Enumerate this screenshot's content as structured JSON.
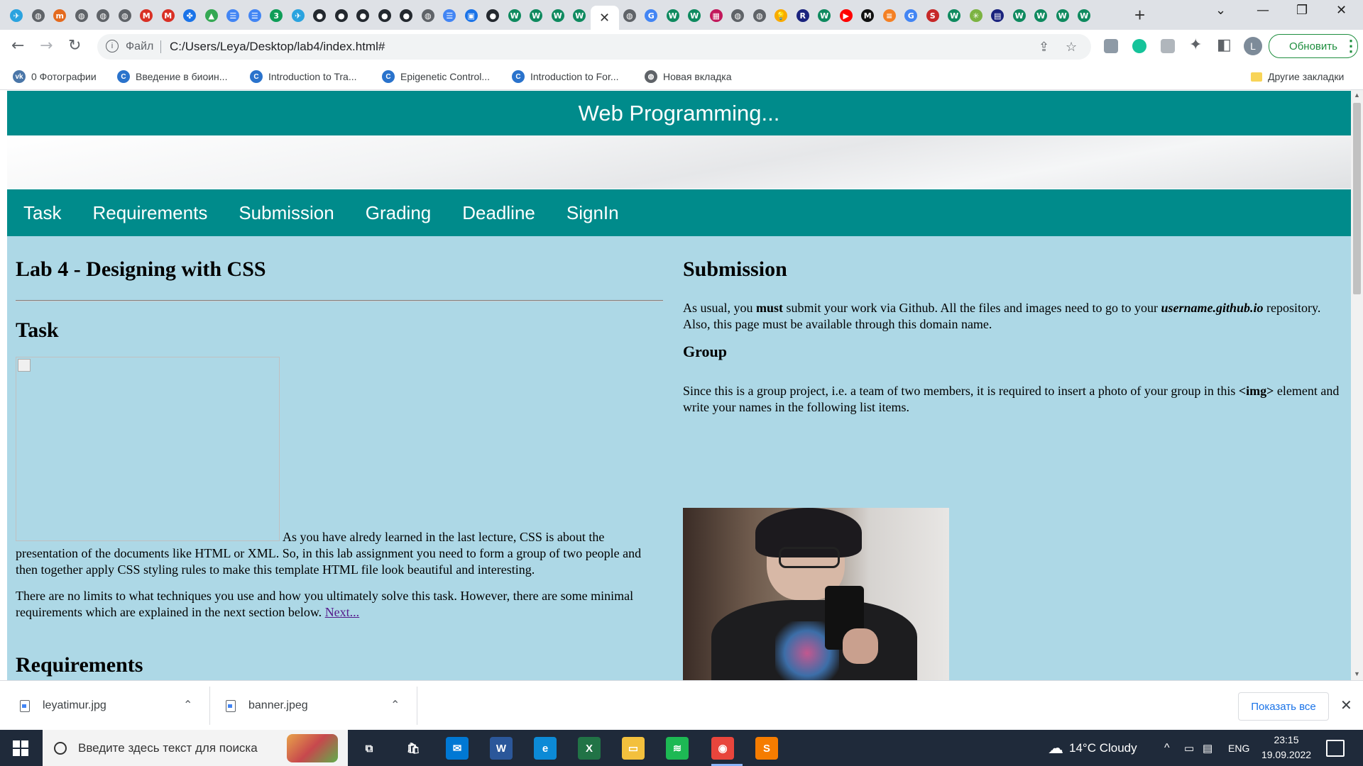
{
  "browser": {
    "tabs": [
      {
        "icon": "telegram-icon",
        "glyph": "✈",
        "color": "#2aa3df"
      },
      {
        "icon": "globe-icon",
        "glyph": "◍",
        "color": "#5f6368"
      },
      {
        "icon": "site-icon",
        "glyph": "m",
        "color": "#e46a1e"
      },
      {
        "icon": "globe-icon",
        "glyph": "◍",
        "color": "#5f6368"
      },
      {
        "icon": "globe-icon",
        "glyph": "◍",
        "color": "#5f6368"
      },
      {
        "icon": "globe-icon",
        "glyph": "◍",
        "color": "#5f6368"
      },
      {
        "icon": "gmail-icon",
        "glyph": "M",
        "color": "#d93025"
      },
      {
        "icon": "gmail-icon",
        "glyph": "M",
        "color": "#d93025"
      },
      {
        "icon": "apps-icon",
        "glyph": "✤",
        "color": "#1a73e8"
      },
      {
        "icon": "drive-icon",
        "glyph": "▲",
        "color": "#34a853"
      },
      {
        "icon": "docs-icon",
        "glyph": "☰",
        "color": "#4285f4"
      },
      {
        "icon": "docs-icon",
        "glyph": "☰",
        "color": "#4285f4"
      },
      {
        "icon": "counter-icon",
        "glyph": "3",
        "color": "#0f9d58"
      },
      {
        "icon": "telegram-icon",
        "glyph": "✈",
        "color": "#2aa3df"
      },
      {
        "icon": "github-icon",
        "glyph": "●",
        "color": "#24292f"
      },
      {
        "icon": "github-icon",
        "glyph": "●",
        "color": "#24292f"
      },
      {
        "icon": "github-icon",
        "glyph": "●",
        "color": "#24292f"
      },
      {
        "icon": "github-icon",
        "glyph": "●",
        "color": "#24292f"
      },
      {
        "icon": "github-icon",
        "glyph": "●",
        "color": "#24292f"
      },
      {
        "icon": "globe-icon",
        "glyph": "◍",
        "color": "#5f6368"
      },
      {
        "icon": "docs-icon",
        "glyph": "☰",
        "color": "#4285f4"
      },
      {
        "icon": "chat-icon",
        "glyph": "▣",
        "color": "#1a73e8"
      },
      {
        "icon": "github-icon",
        "glyph": "●",
        "color": "#24292f"
      },
      {
        "icon": "w-icon",
        "glyph": "W",
        "color": "#0f8a5f"
      },
      {
        "icon": "w-icon",
        "glyph": "W",
        "color": "#0f8a5f"
      },
      {
        "icon": "w-icon",
        "glyph": "W",
        "color": "#0f8a5f"
      },
      {
        "icon": "w-icon",
        "glyph": "W",
        "color": "#0f8a5f"
      },
      {
        "icon": "active-tab",
        "glyph": "✕",
        "color": "#333333",
        "active": true
      },
      {
        "icon": "globe-icon",
        "glyph": "◍",
        "color": "#5f6368"
      },
      {
        "icon": "google-icon",
        "glyph": "G",
        "color": "#4285f4"
      },
      {
        "icon": "w-icon",
        "glyph": "W",
        "color": "#0f8a5f"
      },
      {
        "icon": "w-icon",
        "glyph": "W",
        "color": "#0f8a5f"
      },
      {
        "icon": "grid-icon",
        "glyph": "▦",
        "color": "#c2185b"
      },
      {
        "icon": "globe-icon",
        "glyph": "◍",
        "color": "#5f6368"
      },
      {
        "icon": "globe-icon",
        "glyph": "◍",
        "color": "#5f6368"
      },
      {
        "icon": "bulb-icon",
        "glyph": "💡",
        "color": "#f9ab00"
      },
      {
        "icon": "r-icon",
        "glyph": "R",
        "color": "#1a237e"
      },
      {
        "icon": "w-icon",
        "glyph": "W",
        "color": "#0f8a5f"
      },
      {
        "icon": "youtube-icon",
        "glyph": "▶",
        "color": "#ff0000"
      },
      {
        "icon": "m-icon",
        "glyph": "M",
        "color": "#111111"
      },
      {
        "icon": "stack-icon",
        "glyph": "≡",
        "color": "#f48024"
      },
      {
        "icon": "google-icon",
        "glyph": "G",
        "color": "#4285f4"
      },
      {
        "icon": "sfu-icon",
        "glyph": "S",
        "color": "#c62828"
      },
      {
        "icon": "w-icon",
        "glyph": "W",
        "color": "#0f8a5f"
      },
      {
        "icon": "star-icon",
        "glyph": "✳",
        "color": "#7cb342"
      },
      {
        "icon": "book-icon",
        "glyph": "▤",
        "color": "#1a237e"
      },
      {
        "icon": "w-icon",
        "glyph": "W",
        "color": "#0f8a5f"
      },
      {
        "icon": "w-icon",
        "glyph": "W",
        "color": "#0f8a5f"
      },
      {
        "icon": "w-icon",
        "glyph": "W",
        "color": "#0f8a5f"
      },
      {
        "icon": "w-icon",
        "glyph": "W",
        "color": "#0f8a5f"
      }
    ],
    "address": {
      "scheme_label": "Файл",
      "url": "C:/Users/Leya/Desktop/lab4/index.html#"
    },
    "profile_initial": "L",
    "update_label": "Обновить",
    "bookmarks": [
      {
        "label": "0 Фотографии",
        "icon": "vk-icon",
        "glyph": "vk",
        "color": "#4a76a8"
      },
      {
        "label": "Введение в биоин...",
        "icon": "coursera-icon",
        "glyph": "C",
        "color": "#2a73cc"
      },
      {
        "label": "Introduction to Tra...",
        "icon": "coursera-icon",
        "glyph": "C",
        "color": "#2a73cc"
      },
      {
        "label": "Epigenetic Control...",
        "icon": "coursera-icon",
        "glyph": "C",
        "color": "#2a73cc"
      },
      {
        "label": "Introduction to For...",
        "icon": "coursera-icon",
        "glyph": "C",
        "color": "#2a73cc"
      },
      {
        "label": "Новая вкладка",
        "icon": "globe-icon",
        "glyph": "◍",
        "color": "#5f6368"
      }
    ],
    "other_bookmarks": "Другие закладки"
  },
  "page": {
    "site_title": "Web Programming...",
    "nav": [
      "Task",
      "Requirements",
      "Submission",
      "Grading",
      "Deadline",
      "SignIn"
    ],
    "left": {
      "lab_title": "Lab 4 - Designing with CSS",
      "task_heading": "Task",
      "task_p1": "As you have alredy learned in the last lecture, CSS is about the presentation of the documents like HTML or XML. So, in this lab assignment you need to form a group of two people and then together apply CSS styling rules to make this template HTML file look beautiful and interesting.",
      "task_p2_text": "There are no limits to what techniques you use and how you ultimately solve this task. However, there are some minimal requirements which are explained in the next section below. ",
      "task_p2_link": "Next...",
      "req_heading": "Requirements"
    },
    "right": {
      "sub_heading": "Submission",
      "sub_p_1": "As usual, you ",
      "sub_p_strong": "must",
      "sub_p_2": " submit your work via Github. All the files and images need to go to your ",
      "sub_p_em": "username.github.io",
      "sub_p_3": " repository. Also, this page must be available through this domain name.",
      "group_heading": "Group",
      "group_p_1": "Since this is a group project, i.e. a team of two members, it is required to insert a photo of your group in this ",
      "group_p_code": "<img>",
      "group_p_2": " element and write your names in the following list items."
    }
  },
  "downloads": {
    "items": [
      "leyatimur.jpg",
      "banner.jpeg"
    ],
    "show_all": "Показать все"
  },
  "taskbar": {
    "search_placeholder": "Введите здесь текст для поиска",
    "weather": "14°C  Cloudy",
    "lang": "ENG",
    "time": "23:15",
    "date": "19.09.2022",
    "apps": [
      {
        "name": "task-view-icon",
        "glyph": "⧉",
        "color": "transparent"
      },
      {
        "name": "store-icon",
        "glyph": "🛍",
        "color": "transparent"
      },
      {
        "name": "mail-icon",
        "glyph": "✉",
        "color": "#0078d4"
      },
      {
        "name": "word-icon",
        "glyph": "W",
        "color": "#2b579a"
      },
      {
        "name": "edge-icon",
        "glyph": "e",
        "color": "#0c8ad6"
      },
      {
        "name": "excel-icon",
        "glyph": "X",
        "color": "#217346"
      },
      {
        "name": "explorer-icon",
        "glyph": "▭",
        "color": "#f3c03d"
      },
      {
        "name": "spotify-icon",
        "glyph": "≋",
        "color": "#1db954"
      },
      {
        "name": "chrome-icon",
        "glyph": "◉",
        "color": "#e8453c"
      },
      {
        "name": "sublime-icon",
        "glyph": "S",
        "color": "#f57c00"
      }
    ]
  }
}
